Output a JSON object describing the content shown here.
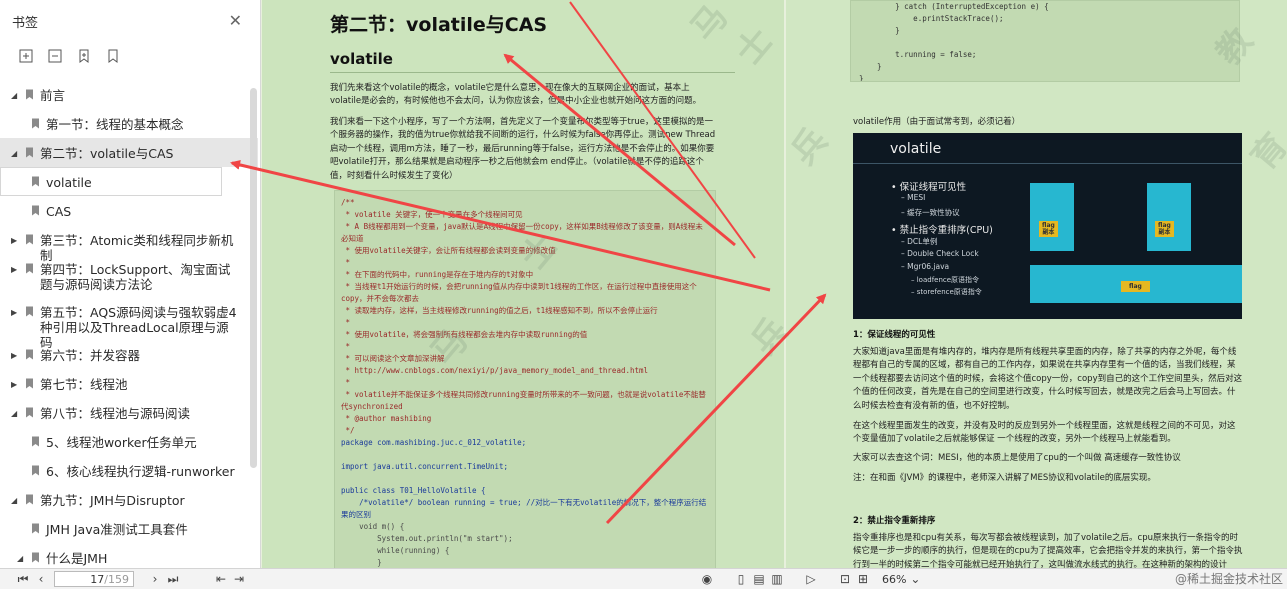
{
  "sidebar": {
    "title": "书签",
    "tools": [
      "add-bookmark-icon",
      "remove-bookmark-icon",
      "bookmark-icon",
      "bookmark-outline-icon"
    ],
    "items": [
      {
        "label": "前言",
        "level": 0,
        "expanded": true
      },
      {
        "label": "第一节：线程的基本概念",
        "level": 1
      },
      {
        "label": "第二节：volatile与CAS",
        "level": 0,
        "expanded": true,
        "selected": true
      },
      {
        "label": "volatile",
        "level": 1,
        "boxed": true
      },
      {
        "label": "CAS",
        "level": 1
      },
      {
        "label": "第三节：Atomic类和线程同步新机制",
        "level": 0,
        "expanded": false
      },
      {
        "label": "第四节：LockSupport、淘宝面试题与源码阅读方法论",
        "level": 0,
        "expanded": false
      },
      {
        "label": "第五节：AQS源码阅读与强软弱虚4种引用以及ThreadLocal原理与源码",
        "level": 0,
        "expanded": false
      },
      {
        "label": "第六节：并发容器",
        "level": 0,
        "expanded": false
      },
      {
        "label": "第七节：线程池",
        "level": 0,
        "expanded": false
      },
      {
        "label": "第八节：线程池与源码阅读",
        "level": 0,
        "expanded": true
      },
      {
        "label": "5、线程池worker任务单元",
        "level": 1
      },
      {
        "label": "6、核心线程执行逻辑-runworker",
        "level": 1
      },
      {
        "label": "第九节：JMH与Disruptor",
        "level": 0,
        "expanded": true
      },
      {
        "label": "JMH Java准测试工具套件",
        "level": 1
      },
      {
        "label": "什么是JMH",
        "level": 1,
        "expanded": true
      }
    ]
  },
  "page1": {
    "heading": "第二节：volatile与CAS",
    "subheading": "volatile",
    "para1": "我们先来看这个volatile的概念，volatile它是什么意思，现在像大的互联网企业的面试，基本上volatile是必会的，有时候他也不会太问，认为你应该会，但是中小企业也就开始问这方面的问题。",
    "para2": "我们来看一下这个小程序，写了一个方法啊，首先定义了一个变量布尔类型等于true，这里模拟的是一个服务器的操作，我的值为true你就给我不间断的运行，什么时候为false你再停止。测试new Thread启动一个线程，调用m方法，睡了一秒，最后running等于false，运行方法他是不会停止的。如果你要吧volatile打开，那么结果就是启动程序一秒之后他就会m end停止。（volatile就是不停的追踪这个值，时刻看什么时候发生了变化）",
    "code": [
      {
        "t": "/**",
        "c": "cm"
      },
      {
        "t": " * volatile 关键字，使一个变量在多个线程间可见",
        "c": "cm"
      },
      {
        "t": " * A B线程都用到一个变量，java默认是A线程中保留一份copy，这样如果B线程修改了该变量，则A线程未必知道",
        "c": "cm"
      },
      {
        "t": " * 使用volatile关键字，会让所有线程都会读到变量的修改值",
        "c": "cm"
      },
      {
        "t": " *",
        "c": "cm"
      },
      {
        "t": " * 在下面的代码中，running是存在于堆内存的t对象中",
        "c": "cm"
      },
      {
        "t": " * 当线程t1开始运行的时候，会把running值从内存中读到t1线程的工作区，在运行过程中直接使用这个copy，并不会每次都去",
        "c": "cm"
      },
      {
        "t": " * 读取堆内存，这样，当主线程修改running的值之后，t1线程感知不到，所以不会停止运行",
        "c": "cm"
      },
      {
        "t": " *",
        "c": "cm"
      },
      {
        "t": " * 使用volatile，将会强制所有线程都会去堆内存中读取running的值",
        "c": "cm"
      },
      {
        "t": " *",
        "c": "cm"
      },
      {
        "t": " * 可以阅读这个文章加深讲解",
        "c": "cm"
      },
      {
        "t": " * http://www.cnblogs.com/nexiyi/p/java_memory_model_and_thread.html",
        "c": "cm"
      },
      {
        "t": " *",
        "c": "cm"
      },
      {
        "t": " * volatile并不能保证多个线程共同修改running变量时所带来的不一致问题，也就是说volatile不能替代synchronized",
        "c": "cm"
      },
      {
        "t": " * @author mashibing",
        "c": "cm"
      },
      {
        "t": " */",
        "c": "cm"
      },
      {
        "t": "package com.mashibing.juc.c_012_volatile;",
        "c": "kw"
      },
      {
        "t": "",
        "c": ""
      },
      {
        "t": "import java.util.concurrent.TimeUnit;",
        "c": "kw"
      },
      {
        "t": "",
        "c": ""
      },
      {
        "t": "public class T01_HelloVolatile {",
        "c": "kw"
      },
      {
        "t": "    /*volatile*/ boolean running = true; //对比一下有无volatile的情况下，整个程序运行结果的区别",
        "c": "kw"
      },
      {
        "t": "    void m() {",
        "c": ""
      },
      {
        "t": "        System.out.println(\"m start\");",
        "c": ""
      },
      {
        "t": "        while(running) {",
        "c": ""
      },
      {
        "t": "        }",
        "c": ""
      }
    ]
  },
  "page2": {
    "code_top": [
      "        } catch (InterruptedException e) {",
      "            e.printStackTrace();",
      "        }",
      "",
      "        t.running = false;",
      "    }",
      "}"
    ],
    "caption": "volatile作用（由于面试常考到，必须记着）",
    "slide": {
      "title": "volatile",
      "points": [
        {
          "text": "保证线程可见性",
          "level": 0
        },
        {
          "text": "MESI",
          "level": 1
        },
        {
          "text": "缓存一致性协议",
          "level": 1
        },
        {
          "text": "禁止指令重排序(CPU)",
          "level": 0
        },
        {
          "text": "DCL单例",
          "level": 1
        },
        {
          "text": "Double Check Lock",
          "level": 1
        },
        {
          "text": "Mgr06.java",
          "level": 1
        },
        {
          "text": "loadfence原语指令",
          "level": 2
        },
        {
          "text": "storefence原语指令",
          "level": 2
        }
      ],
      "flag1": "flag\n副本",
      "flag2": "flag\n副本",
      "flag3": "flag"
    },
    "sec1_title": "1：保证线程的可见性",
    "sec1_p1": "大家知道java里面是有堆内存的，堆内存是所有线程共享里面的内存，除了共享的内存之外呢，每个线程都有自己的专属的区域，都有自己的工作内存，如果说在共享内存里有一个值的话，当我们线程，某一个线程都要去访问这个值的时候，会将这个值copy一份，copy到自己的这个工作空间里头，然后对这个值的任何改变，首先是在自己的空间里进行改变，什么时候写回去，就是改完之后会马上写回去。什么时候去检查有没有新的值，也不好控制。",
    "sec1_p2": "在这个线程里面发生的改变，并没有及时的反应到另外一个线程里面，这就是线程之间的不可见，对这个变量值加了volatile之后就能够保证 一个线程的改变，另外一个线程马上就能看到。",
    "sec1_p3": "大家可以去查这个词：MESI，他的本质上是使用了cpu的一个叫做 高速缓存一致性协议",
    "sec1_p4": "注：在和面《JVM》的课程中，老师深入讲解了MES协议和volatile的底层实现。",
    "sec2_title": "2：禁止指令重新排序",
    "sec2_p1": "指令重排序也是和cpu有关系，每次写都会被线程读到，加了volatile之后。cpu原来执行一条指令的时候它是一步一步的顺序的执行，但是现在的cpu为了提高效率，它会把指令并发的来执行，第一个指令执行到一半的时候第二个指令可能就已经开始执行了，这叫做流水线式的执行。在这种新的架构的设计"
  },
  "watermark": [
    "马",
    "士",
    "兵",
    "教",
    "育"
  ],
  "toolbar": {
    "page_current": "17",
    "page_total": "/159",
    "zoom": "66%",
    "credit": "@稀土掘金技术社区"
  }
}
